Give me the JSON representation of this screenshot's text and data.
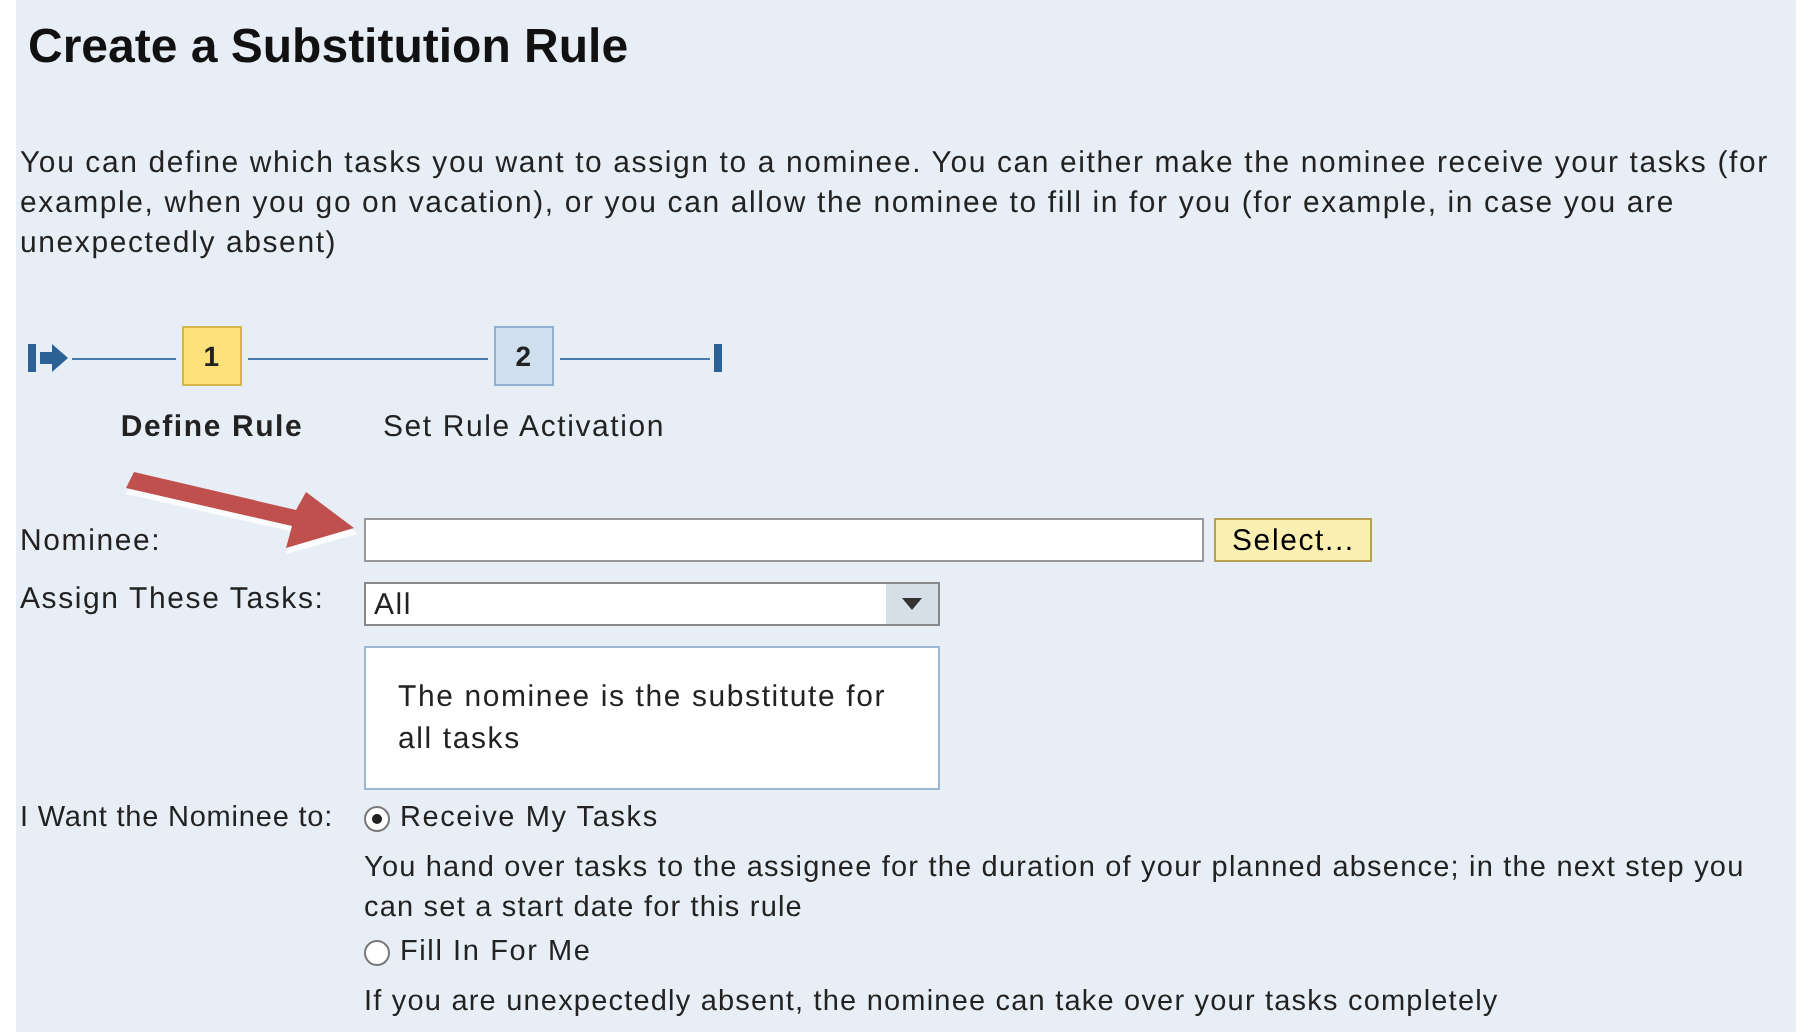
{
  "title": "Create a Substitution Rule",
  "intro": "You can define which tasks you want to assign to a nominee. You can either make the nominee receive your tasks (for example, when you go on vacation), or you can allow the nominee to fill in for you (for example, in case you are unexpectedly absent)",
  "steps": [
    {
      "number": "1",
      "label": "Define Rule",
      "selected": true
    },
    {
      "number": "2",
      "label": "Set Rule Activation",
      "selected": false
    }
  ],
  "nominee": {
    "label": "Nominee:",
    "button": "Select..."
  },
  "assign": {
    "label": "Assign These Tasks:",
    "value": "All",
    "description": "The nominee is the substitute for all tasks"
  },
  "want": {
    "label": "I Want the Nominee to:",
    "options": [
      {
        "label": "Receive My Tasks",
        "selected": true,
        "description": "You hand over tasks to the assignee for the duration of your planned absence; in the next step you can set a start date for this rule"
      },
      {
        "label": "Fill In For Me",
        "selected": false,
        "description": "If you are unexpectedly absent, the nominee can take over your tasks completely"
      }
    ]
  }
}
